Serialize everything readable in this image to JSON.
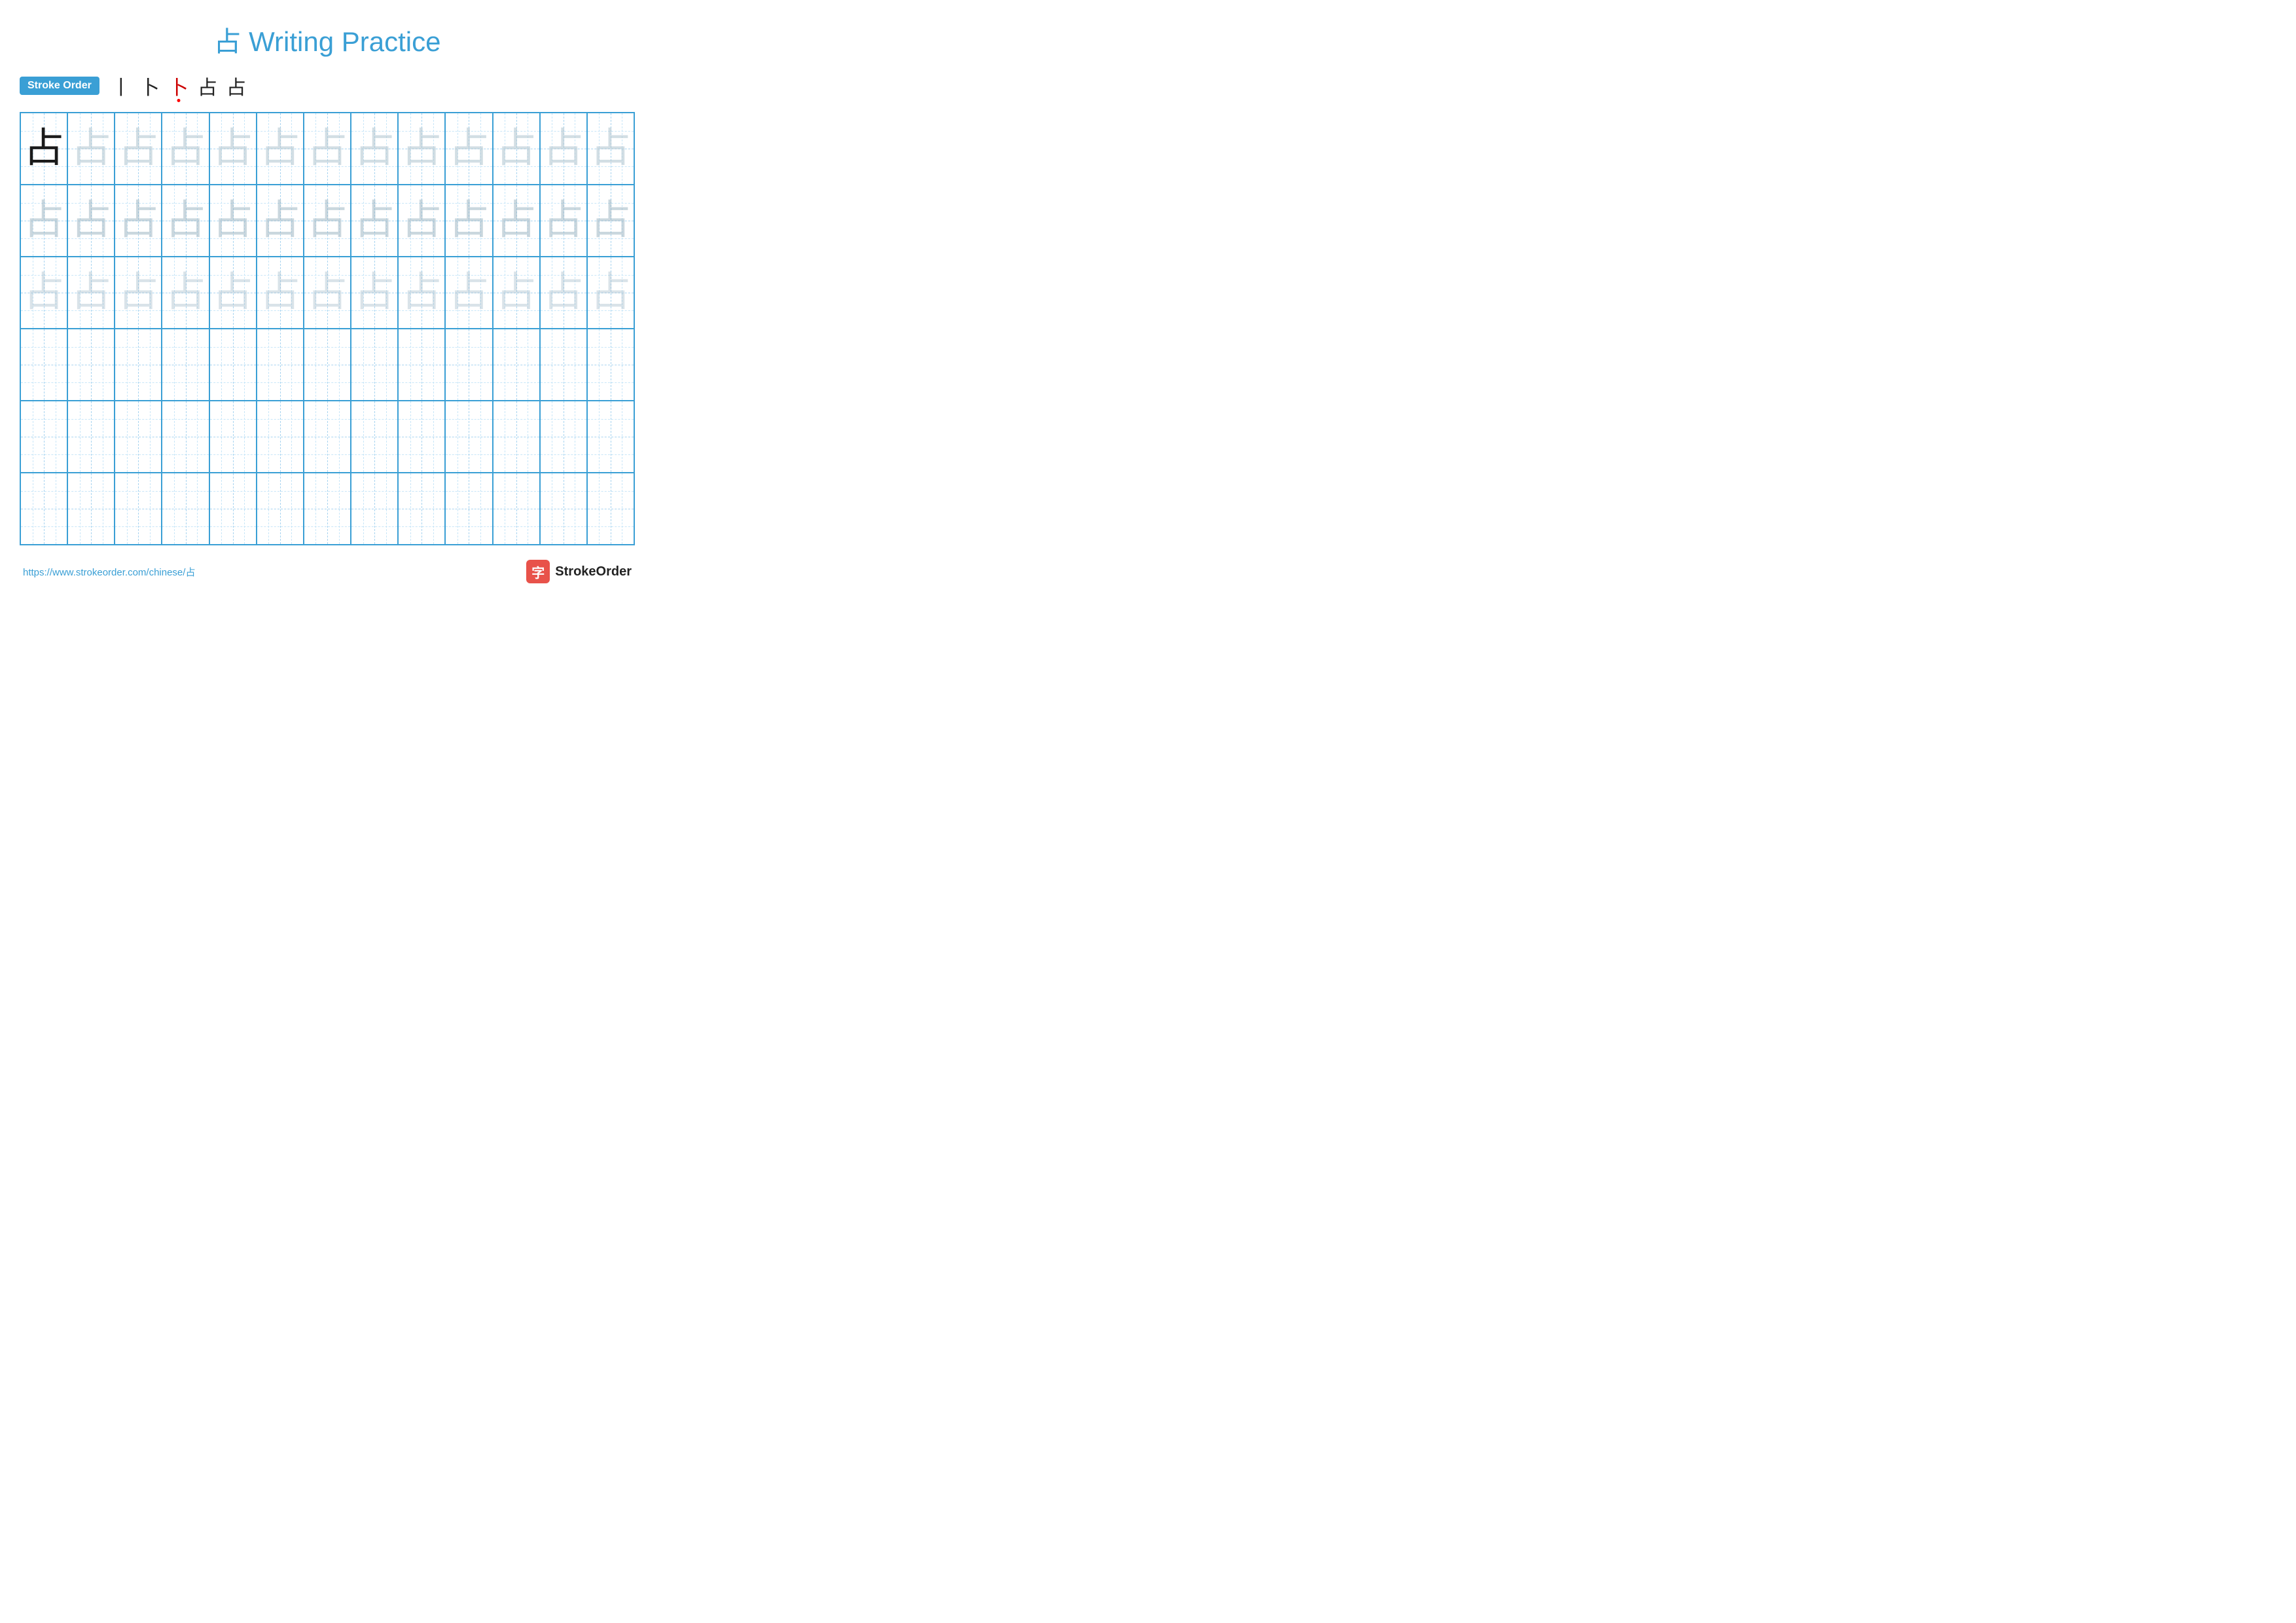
{
  "page": {
    "title": "占 Writing Practice",
    "character": "占"
  },
  "stroke_order": {
    "badge_label": "Stroke Order",
    "strokes": [
      "丨",
      "卜",
      "卜",
      "占",
      "占"
    ]
  },
  "grid": {
    "rows": 6,
    "cols": 13,
    "filled_rows": 3,
    "char": "占"
  },
  "footer": {
    "url": "https://www.strokeorder.com/chinese/占",
    "brand_name": "StrokeOrder",
    "brand_icon_char": "字"
  }
}
